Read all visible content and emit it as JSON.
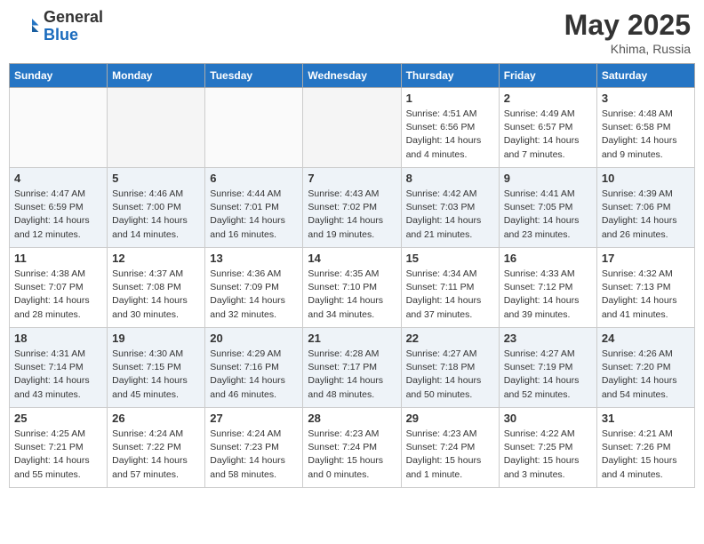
{
  "header": {
    "logo_line1": "General",
    "logo_line2": "Blue",
    "month_year": "May 2025",
    "location": "Khima, Russia"
  },
  "days_of_week": [
    "Sunday",
    "Monday",
    "Tuesday",
    "Wednesday",
    "Thursday",
    "Friday",
    "Saturday"
  ],
  "weeks": [
    [
      {
        "day": "",
        "info": ""
      },
      {
        "day": "",
        "info": ""
      },
      {
        "day": "",
        "info": ""
      },
      {
        "day": "",
        "info": ""
      },
      {
        "day": "1",
        "info": "Sunrise: 4:51 AM\nSunset: 6:56 PM\nDaylight: 14 hours\nand 4 minutes."
      },
      {
        "day": "2",
        "info": "Sunrise: 4:49 AM\nSunset: 6:57 PM\nDaylight: 14 hours\nand 7 minutes."
      },
      {
        "day": "3",
        "info": "Sunrise: 4:48 AM\nSunset: 6:58 PM\nDaylight: 14 hours\nand 9 minutes."
      }
    ],
    [
      {
        "day": "4",
        "info": "Sunrise: 4:47 AM\nSunset: 6:59 PM\nDaylight: 14 hours\nand 12 minutes."
      },
      {
        "day": "5",
        "info": "Sunrise: 4:46 AM\nSunset: 7:00 PM\nDaylight: 14 hours\nand 14 minutes."
      },
      {
        "day": "6",
        "info": "Sunrise: 4:44 AM\nSunset: 7:01 PM\nDaylight: 14 hours\nand 16 minutes."
      },
      {
        "day": "7",
        "info": "Sunrise: 4:43 AM\nSunset: 7:02 PM\nDaylight: 14 hours\nand 19 minutes."
      },
      {
        "day": "8",
        "info": "Sunrise: 4:42 AM\nSunset: 7:03 PM\nDaylight: 14 hours\nand 21 minutes."
      },
      {
        "day": "9",
        "info": "Sunrise: 4:41 AM\nSunset: 7:05 PM\nDaylight: 14 hours\nand 23 minutes."
      },
      {
        "day": "10",
        "info": "Sunrise: 4:39 AM\nSunset: 7:06 PM\nDaylight: 14 hours\nand 26 minutes."
      }
    ],
    [
      {
        "day": "11",
        "info": "Sunrise: 4:38 AM\nSunset: 7:07 PM\nDaylight: 14 hours\nand 28 minutes."
      },
      {
        "day": "12",
        "info": "Sunrise: 4:37 AM\nSunset: 7:08 PM\nDaylight: 14 hours\nand 30 minutes."
      },
      {
        "day": "13",
        "info": "Sunrise: 4:36 AM\nSunset: 7:09 PM\nDaylight: 14 hours\nand 32 minutes."
      },
      {
        "day": "14",
        "info": "Sunrise: 4:35 AM\nSunset: 7:10 PM\nDaylight: 14 hours\nand 34 minutes."
      },
      {
        "day": "15",
        "info": "Sunrise: 4:34 AM\nSunset: 7:11 PM\nDaylight: 14 hours\nand 37 minutes."
      },
      {
        "day": "16",
        "info": "Sunrise: 4:33 AM\nSunset: 7:12 PM\nDaylight: 14 hours\nand 39 minutes."
      },
      {
        "day": "17",
        "info": "Sunrise: 4:32 AM\nSunset: 7:13 PM\nDaylight: 14 hours\nand 41 minutes."
      }
    ],
    [
      {
        "day": "18",
        "info": "Sunrise: 4:31 AM\nSunset: 7:14 PM\nDaylight: 14 hours\nand 43 minutes."
      },
      {
        "day": "19",
        "info": "Sunrise: 4:30 AM\nSunset: 7:15 PM\nDaylight: 14 hours\nand 45 minutes."
      },
      {
        "day": "20",
        "info": "Sunrise: 4:29 AM\nSunset: 7:16 PM\nDaylight: 14 hours\nand 46 minutes."
      },
      {
        "day": "21",
        "info": "Sunrise: 4:28 AM\nSunset: 7:17 PM\nDaylight: 14 hours\nand 48 minutes."
      },
      {
        "day": "22",
        "info": "Sunrise: 4:27 AM\nSunset: 7:18 PM\nDaylight: 14 hours\nand 50 minutes."
      },
      {
        "day": "23",
        "info": "Sunrise: 4:27 AM\nSunset: 7:19 PM\nDaylight: 14 hours\nand 52 minutes."
      },
      {
        "day": "24",
        "info": "Sunrise: 4:26 AM\nSunset: 7:20 PM\nDaylight: 14 hours\nand 54 minutes."
      }
    ],
    [
      {
        "day": "25",
        "info": "Sunrise: 4:25 AM\nSunset: 7:21 PM\nDaylight: 14 hours\nand 55 minutes."
      },
      {
        "day": "26",
        "info": "Sunrise: 4:24 AM\nSunset: 7:22 PM\nDaylight: 14 hours\nand 57 minutes."
      },
      {
        "day": "27",
        "info": "Sunrise: 4:24 AM\nSunset: 7:23 PM\nDaylight: 14 hours\nand 58 minutes."
      },
      {
        "day": "28",
        "info": "Sunrise: 4:23 AM\nSunset: 7:24 PM\nDaylight: 15 hours\nand 0 minutes."
      },
      {
        "day": "29",
        "info": "Sunrise: 4:23 AM\nSunset: 7:24 PM\nDaylight: 15 hours\nand 1 minute."
      },
      {
        "day": "30",
        "info": "Sunrise: 4:22 AM\nSunset: 7:25 PM\nDaylight: 15 hours\nand 3 minutes."
      },
      {
        "day": "31",
        "info": "Sunrise: 4:21 AM\nSunset: 7:26 PM\nDaylight: 15 hours\nand 4 minutes."
      }
    ]
  ]
}
